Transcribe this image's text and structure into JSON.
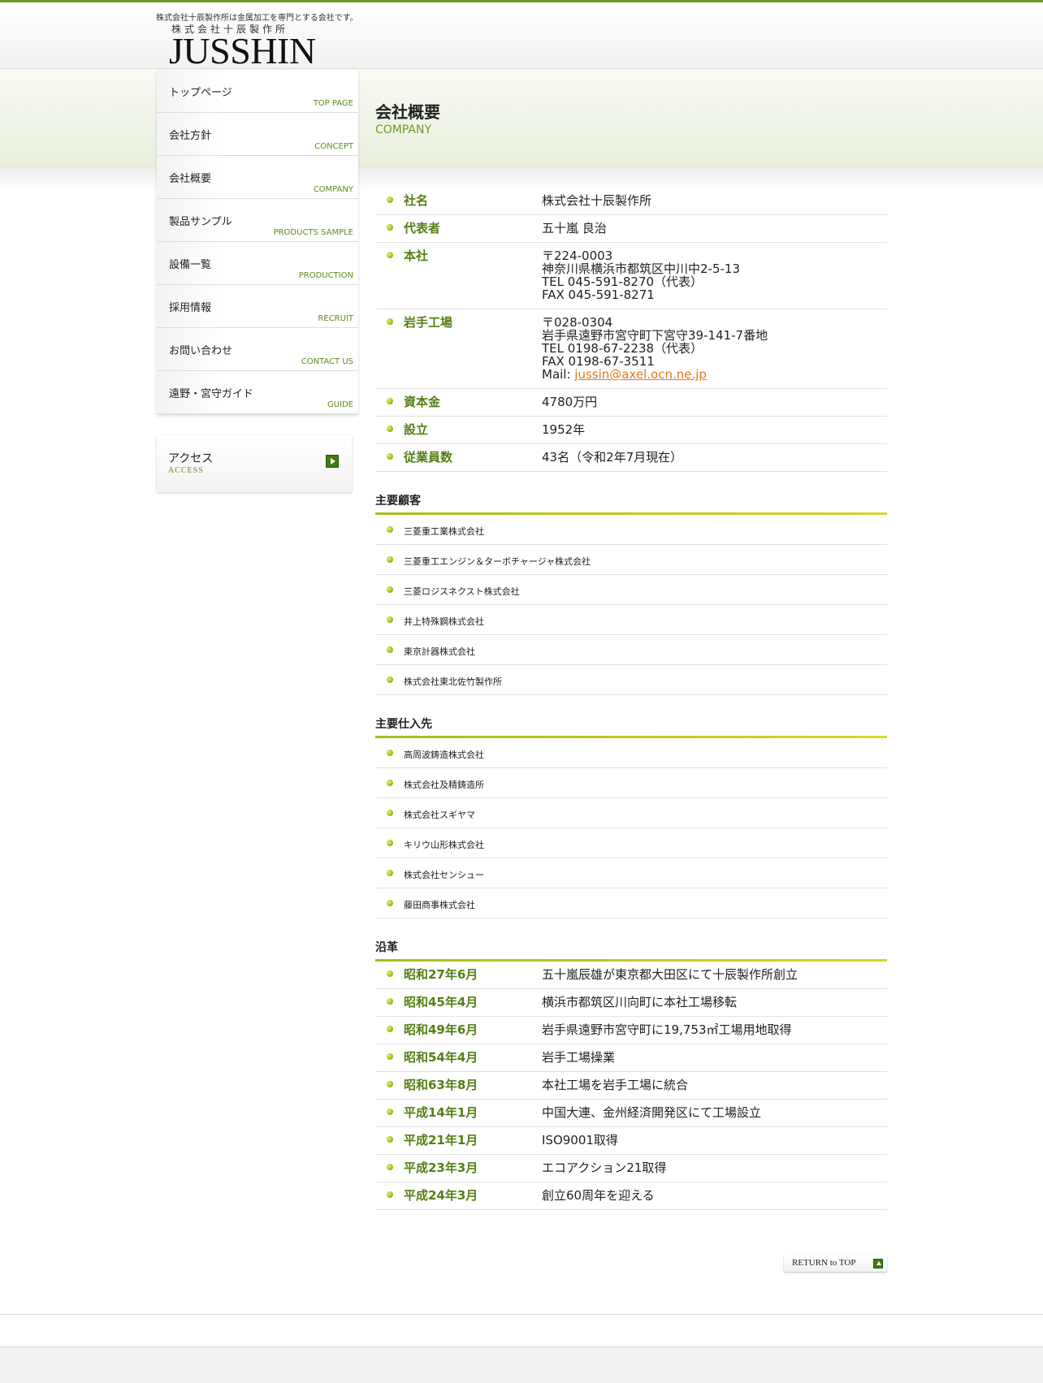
{
  "header": {
    "tagline": "株式会社十辰製作所は金属加工を専門とする会社です。",
    "logo_sub": "株式会社十辰製作所",
    "logo": "JUSSHIN"
  },
  "nav": {
    "items": [
      {
        "jp": "トップページ",
        "en": "TOP PAGE"
      },
      {
        "jp": "会社方針",
        "en": "CONCEPT"
      },
      {
        "jp": "会社概要",
        "en": "COMPANY"
      },
      {
        "jp": "製品サンプル",
        "en": "PRODUCTS SAMPLE"
      },
      {
        "jp": "設備一覧",
        "en": "PRODUCTION"
      },
      {
        "jp": "採用情報",
        "en": "RECRUIT"
      },
      {
        "jp": "お問い合わせ",
        "en": "CONTACT US"
      },
      {
        "jp": "遠野・宮守ガイド",
        "en": "GUIDE"
      }
    ],
    "access": {
      "jp": "アクセス",
      "en": "ACCESS"
    }
  },
  "page": {
    "title": "会社概要",
    "subtitle": "COMPANY"
  },
  "company": [
    {
      "label": "社名",
      "lines": [
        "株式会社十辰製作所"
      ]
    },
    {
      "label": "代表者",
      "lines": [
        "五十嵐 良治"
      ]
    },
    {
      "label": "本社",
      "lines": [
        "〒224-0003",
        "神奈川県横浜市都筑区中川中2-5-13",
        "TEL 045-591-8270（代表）",
        "FAX 045-591-8271"
      ]
    },
    {
      "label": "岩手工場",
      "lines": [
        "〒028-0304",
        "岩手県遠野市宮守町下宮守39-141-7番地",
        "TEL 0198-67-2238（代表）",
        "FAX 0198-67-3511"
      ],
      "mail_prefix": "Mail: ",
      "mail": "jussin@axel.ocn.ne.jp"
    },
    {
      "label": "資本金",
      "lines": [
        "4780万円"
      ]
    },
    {
      "label": "設立",
      "lines": [
        "1952年"
      ]
    },
    {
      "label": "従業員数",
      "lines": [
        "43名（令和2年7月現在）"
      ]
    }
  ],
  "customers": {
    "heading": "主要顧客",
    "items": [
      "三菱重工業株式会社",
      "三菱重工エンジン＆ターボチャージャ株式会社",
      "三菱ロジスネクスト株式会社",
      "井上特殊鋼株式会社",
      "東京計器株式会社",
      "株式会社東北佐竹製作所"
    ]
  },
  "suppliers": {
    "heading": "主要仕入先",
    "items": [
      "高周波鋳造株式会社",
      "株式会社及精鋳造所",
      "株式会社スギヤマ",
      "キリウ山形株式会社",
      "株式会社センシュー",
      "藤田商事株式会社"
    ]
  },
  "history": {
    "heading": "沿革",
    "items": [
      {
        "date": "昭和27年6月",
        "text": "五十嵐辰雄が東京都大田区にて十辰製作所創立"
      },
      {
        "date": "昭和45年4月",
        "text": "横浜市都筑区川向町に本社工場移転"
      },
      {
        "date": "昭和49年6月",
        "text": "岩手県遠野市宮守町に19,753㎡工場用地取得"
      },
      {
        "date": "昭和54年4月",
        "text": "岩手工場操業"
      },
      {
        "date": "昭和63年8月",
        "text": "本社工場を岩手工場に統合"
      },
      {
        "date": "平成14年1月",
        "text": "中国大連、金州経済開発区にて工場設立"
      },
      {
        "date": "平成21年1月",
        "text": "ISO9001取得"
      },
      {
        "date": "平成23年3月",
        "text": "エコアクション21取得"
      },
      {
        "date": "平成24年3月",
        "text": "創立60周年を迎える"
      }
    ]
  },
  "return_label": "RETURN to TOP",
  "colors": {
    "accent_green": "#557f14",
    "nav_en_green": "#5f8b1a",
    "link_orange": "#e07a1a",
    "top_line": "#6f9a1e"
  }
}
